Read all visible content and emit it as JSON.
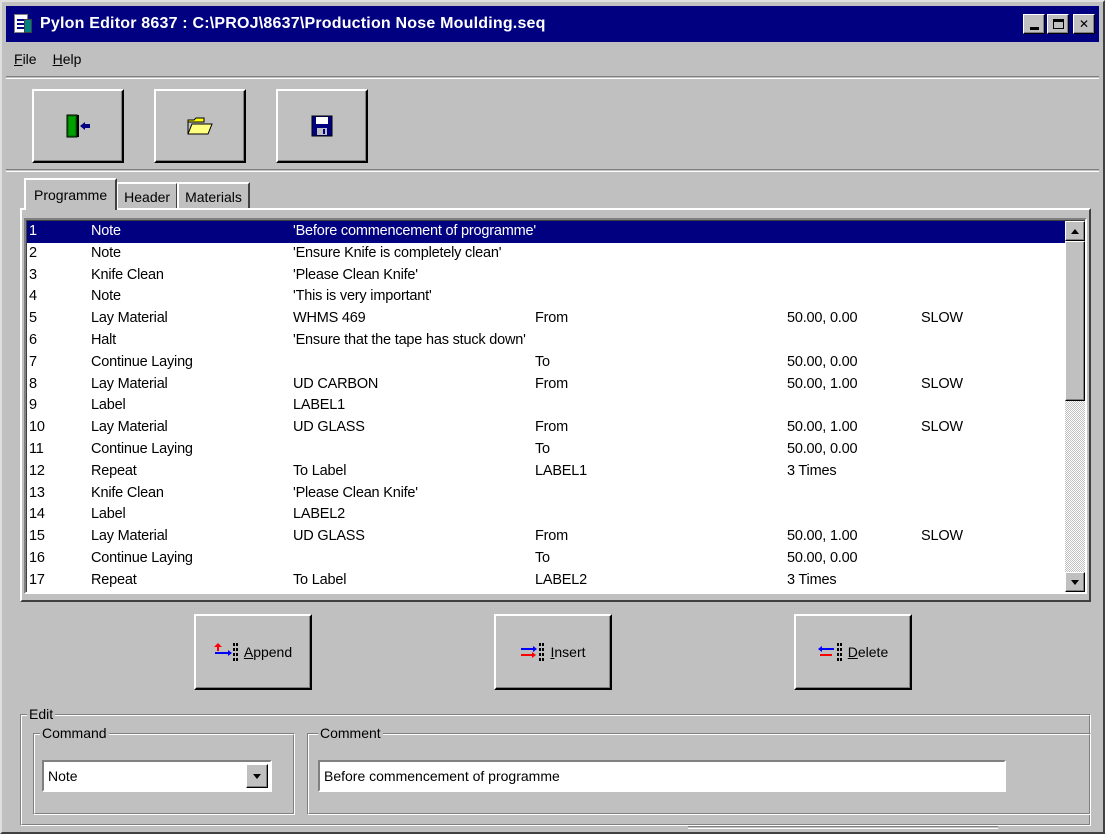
{
  "window": {
    "title": "Pylon Editor 8637 : C:\\PROJ\\8637\\Production Nose Moulding.seq"
  },
  "menu": {
    "file": {
      "accel": "F",
      "rest": "ile"
    },
    "help": {
      "accel": "H",
      "rest": "elp"
    }
  },
  "toolbar": {
    "buttons": [
      {
        "icon": "exit-door-icon"
      },
      {
        "icon": "open-folder-icon"
      },
      {
        "icon": "save-disk-icon"
      }
    ]
  },
  "tabs": [
    "Programme",
    "Header",
    "Materials"
  ],
  "programme": {
    "rows": [
      {
        "n": "1",
        "cmd": "Note",
        "a": "'Before commencement of programme'",
        "b": "",
        "c": "",
        "d": ""
      },
      {
        "n": "2",
        "cmd": "Note",
        "a": "'Ensure Knife is completely clean'",
        "b": "",
        "c": "",
        "d": ""
      },
      {
        "n": "3",
        "cmd": "Knife Clean",
        "a": "'Please Clean Knife'",
        "b": "",
        "c": "",
        "d": ""
      },
      {
        "n": "4",
        "cmd": "Note",
        "a": "'This is very important'",
        "b": "",
        "c": "",
        "d": ""
      },
      {
        "n": "5",
        "cmd": "Lay Material",
        "a": "WHMS 469",
        "b": "From",
        "c": "50.00, 0.00",
        "d": "SLOW"
      },
      {
        "n": "6",
        "cmd": "Halt",
        "a": "'Ensure that the tape has stuck down'",
        "b": "",
        "c": "",
        "d": ""
      },
      {
        "n": "7",
        "cmd": "Continue Laying",
        "a": "",
        "b": "To",
        "c": "50.00, 0.00",
        "d": ""
      },
      {
        "n": "8",
        "cmd": "Lay Material",
        "a": "UD CARBON",
        "b": "From",
        "c": "50.00, 1.00",
        "d": "SLOW"
      },
      {
        "n": "9",
        "cmd": "Label",
        "a": "LABEL1",
        "b": "",
        "c": "",
        "d": ""
      },
      {
        "n": "10",
        "cmd": "Lay Material",
        "a": "UD GLASS",
        "b": "From",
        "c": "50.00, 1.00",
        "d": "SLOW"
      },
      {
        "n": "11",
        "cmd": "Continue Laying",
        "a": "",
        "b": "To",
        "c": "50.00, 0.00",
        "d": ""
      },
      {
        "n": "12",
        "cmd": "Repeat",
        "a": "To Label",
        "b": "LABEL1",
        "c": "3 Times",
        "d": ""
      },
      {
        "n": "13",
        "cmd": "Knife Clean",
        "a": "'Please Clean Knife'",
        "b": "",
        "c": "",
        "d": ""
      },
      {
        "n": "14",
        "cmd": "Label",
        "a": "LABEL2",
        "b": "",
        "c": "",
        "d": ""
      },
      {
        "n": "15",
        "cmd": "Lay Material",
        "a": "UD GLASS",
        "b": "From",
        "c": "50.00, 1.00",
        "d": "SLOW"
      },
      {
        "n": "16",
        "cmd": "Continue Laying",
        "a": "",
        "b": "To",
        "c": "50.00, 0.00",
        "d": ""
      },
      {
        "n": "17",
        "cmd": "Repeat",
        "a": "To Label",
        "b": "LABEL2",
        "c": "3 Times",
        "d": ""
      }
    ],
    "selected_index": 0
  },
  "actions": {
    "append": {
      "accel": "A",
      "rest": "ppend"
    },
    "insert": {
      "accel": "I",
      "rest": "nsert"
    },
    "delete": {
      "accel": "D",
      "rest": "elete"
    }
  },
  "edit": {
    "group_label": "Edit",
    "command_label": "Command",
    "command_value": "Note",
    "comment_label": "Comment",
    "comment_value": "Before commencement of programme"
  },
  "colors": {
    "face": "#c0c0c0",
    "titlebar": "#000080",
    "selection": "#000080"
  }
}
